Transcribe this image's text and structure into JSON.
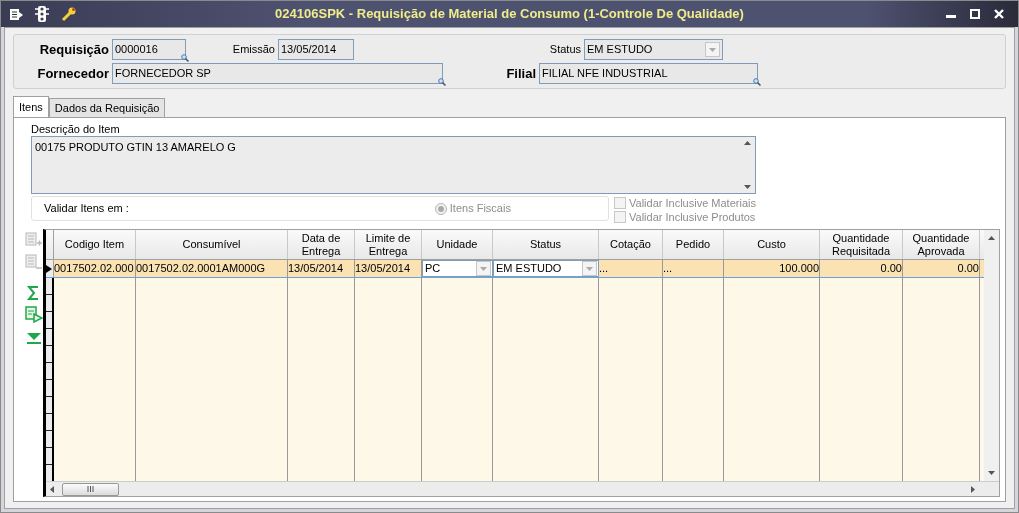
{
  "window": {
    "title": "024106SPK - Requisição de Material de Consumo (1-Controle De Qualidade)"
  },
  "header": {
    "fields": [
      {
        "kind": "lookup",
        "label": "Requisição",
        "bold": true,
        "value": "0000016"
      },
      {
        "kind": "date",
        "label": "Emissão",
        "bold": false,
        "value": "13/05/2014"
      },
      {
        "kind": "select",
        "label": "Status",
        "bold": false,
        "value": "EM ESTUDO"
      },
      {
        "kind": "lookup",
        "label": "Fornecedor",
        "bold": true,
        "value": "FORNECEDOR SP"
      },
      {
        "kind": "lookup",
        "label": "Filial",
        "bold": true,
        "value": "FILIAL NFE INDUSTRIAL"
      }
    ]
  },
  "tabs": [
    {
      "label": "Itens",
      "selected": true
    },
    {
      "label": "Dados da Requisição",
      "selected": false
    }
  ],
  "description": {
    "label": "Descrição do Item",
    "value": "00175 PRODUTO GTIN 13 AMARELO G"
  },
  "validation": {
    "label": "Validar Itens em :",
    "radio": {
      "label": "Itens Fiscais",
      "selected": true,
      "disabled": true
    },
    "checkboxes": [
      {
        "label": "Validar Inclusive Materiais",
        "checked": false,
        "disabled": true
      },
      {
        "label": "Validar Inclusive Produtos",
        "checked": false,
        "disabled": true
      }
    ]
  },
  "tools": [
    {
      "kind": "add-row",
      "disabled": true
    },
    {
      "kind": "remove-row",
      "disabled": true
    },
    {
      "kind": "sum",
      "disabled": false
    },
    {
      "kind": "run",
      "disabled": false
    },
    {
      "kind": "down",
      "disabled": false
    }
  ],
  "grid": {
    "columns": [
      {
        "label": "Codigo Item",
        "kind": "text"
      },
      {
        "label": "Consumível",
        "kind": "text"
      },
      {
        "label": "Data de Entrega",
        "kind": "text"
      },
      {
        "label": "Limite de Entrega",
        "kind": "text"
      },
      {
        "label": "Unidade",
        "kind": "select"
      },
      {
        "label": "Status",
        "kind": "select"
      },
      {
        "label": "Cotação",
        "kind": "text"
      },
      {
        "label": "Pedido",
        "kind": "text"
      },
      {
        "label": "Custo",
        "kind": "number"
      },
      {
        "label": "Quantidade Requisitada",
        "kind": "number"
      },
      {
        "label": "Quantidade Aprovada",
        "kind": "number"
      }
    ],
    "rows": [
      {
        "selected": true,
        "cells": [
          "0017502.02.000",
          "0017502.02.0001AM000G",
          "13/05/2014",
          "13/05/2014",
          "PC",
          "EM ESTUDO",
          "...",
          "...",
          "100.000",
          "0.00",
          "0.00"
        ]
      }
    ]
  }
}
